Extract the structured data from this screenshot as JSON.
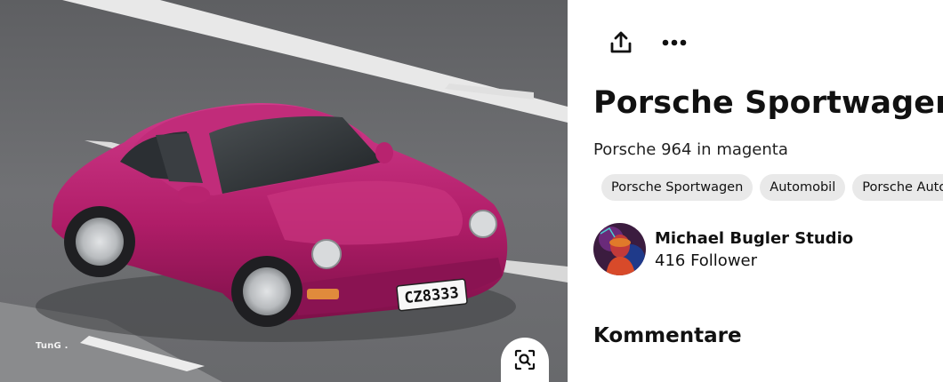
{
  "pin": {
    "image": {
      "alt_subject": "magenta Porsche 964 on road",
      "watermark": "TunG .",
      "license_plate": "CZ8333",
      "lens_icon": "visual-search-icon"
    },
    "actions": {
      "share_icon": "share-icon",
      "more_icon": "more-dots-icon"
    },
    "title": "Porsche Sportwagen",
    "description": "Porsche 964 in magenta",
    "tags": [
      "Porsche Sportwagen",
      "Automobil",
      "Porsche Autos"
    ]
  },
  "creator": {
    "name": "Michael Bugler Studio",
    "followers": "416 Follower"
  },
  "comments": {
    "heading": "Kommentare"
  },
  "colors": {
    "car_body": "#b8206f",
    "road": "#6d6e70",
    "tag_bg": "#e9e9e9",
    "text": "#111111"
  }
}
